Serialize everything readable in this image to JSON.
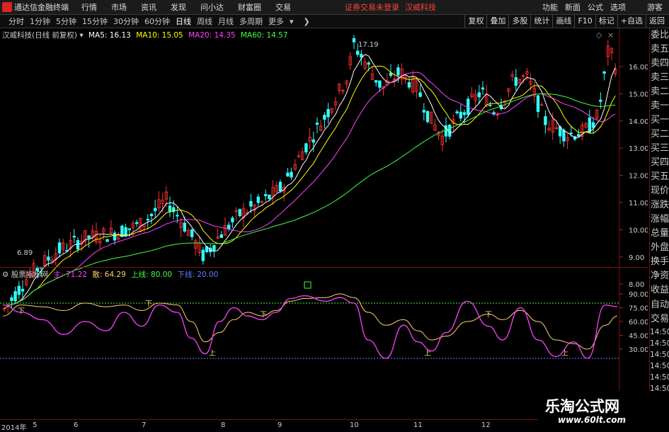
{
  "menubar": {
    "app_title": "通达信金融终端",
    "items": [
      "行情",
      "市场",
      "资讯",
      "发现",
      "问小达",
      "财富圈",
      "交易"
    ],
    "notice": "证券交易未登录",
    "stock": "汉威科技",
    "right_items": [
      "功能",
      "新面",
      "公式",
      "选项",
      "游客"
    ]
  },
  "toolbar": {
    "periods": [
      "分时",
      "1分钟",
      "5分钟",
      "15分钟",
      "30分钟",
      "60分钟",
      "日线",
      "周线",
      "月线",
      "多周期",
      "更多"
    ],
    "right_buttons": [
      "复权",
      "叠加",
      "多股",
      "统计",
      "画线",
      "F10",
      "标记",
      "+自选",
      "返回"
    ]
  },
  "main": {
    "title": "汉威科技(日线 前复权)",
    "ma": [
      {
        "label": "MA5: 16.13",
        "color": "#ffffff"
      },
      {
        "label": "MA10: 15.05",
        "color": "#ffff00"
      },
      {
        "label": "MA20: 14.35",
        "color": "#ff40ff"
      },
      {
        "label": "MA60: 14.57",
        "color": "#40ff40"
      }
    ],
    "high_label": "17.19",
    "low_label": "6.89",
    "price_ticks": [
      "16.00",
      "15.00",
      "14.00",
      "13.00",
      "12.00",
      "11.00",
      "10.00",
      "9.00",
      "8.00"
    ]
  },
  "osc": {
    "title": "股票指标网",
    "legend": [
      {
        "label": "主: 71.22",
        "color": "#ff40ff"
      },
      {
        "label": "散: 64.29",
        "color": "#ffd070"
      },
      {
        "label": "上线: 80.00",
        "color": "#40ff40"
      },
      {
        "label": "下线: 20.00",
        "color": "#6080ff"
      }
    ],
    "ticks": [
      "90.00",
      "75.00",
      "60.00",
      "45.00",
      "30.00"
    ],
    "up_mark": "上",
    "down_mark": "下"
  },
  "side": {
    "cells": [
      "委比",
      "卖五",
      "卖四",
      "卖三",
      "卖二",
      "卖一",
      "买一",
      "买二",
      "买三",
      "买四",
      "买五",
      "现价",
      "涨跌",
      "涨幅",
      "总量",
      "外盘",
      "换手",
      "净资",
      "收益"
    ],
    "cells2": [
      "自动",
      "交易"
    ],
    "times": [
      "14:50",
      "14:50",
      "14:50",
      "14:50",
      "14:50",
      "14:50",
      "14:50",
      "14:50"
    ]
  },
  "axis": {
    "labels": [
      "2014年",
      "5",
      "6",
      "7",
      "8",
      "9",
      "10",
      "11",
      "12"
    ]
  },
  "watermark": {
    "title": "乐淘公式网",
    "url": "www.60lt.com"
  },
  "colors": {
    "up": "#ff3030",
    "down": "#30ffff",
    "panel_border": "#7a1010"
  }
}
